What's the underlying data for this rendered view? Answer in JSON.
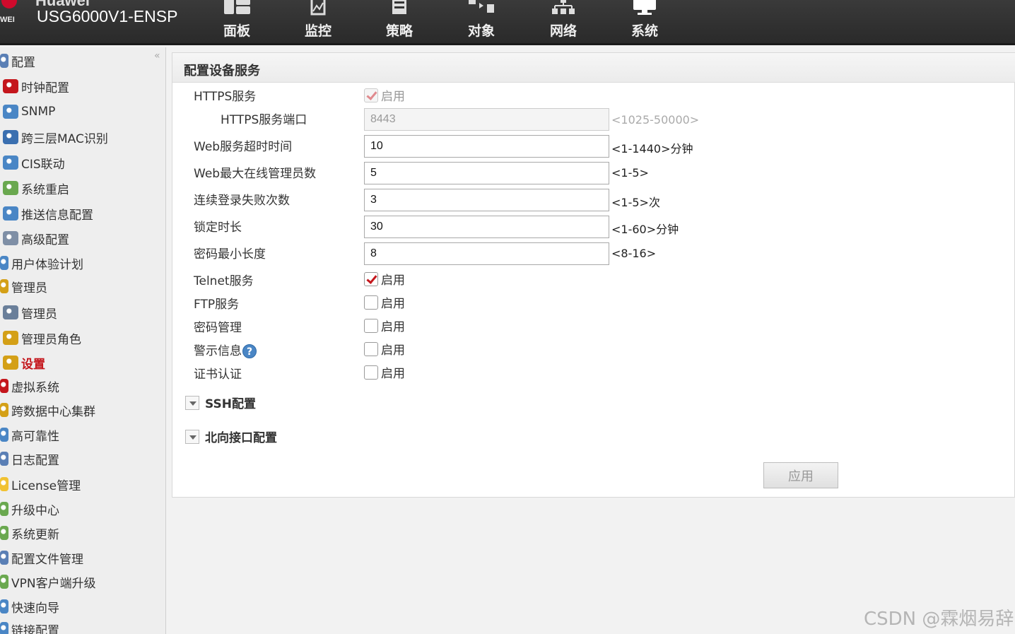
{
  "header": {
    "brand_top": "Huawei",
    "brand_short": "WEI",
    "device_name": "USG6000V1-ENSP",
    "nav": [
      {
        "label": "面板",
        "icon": "dashboard-icon"
      },
      {
        "label": "监控",
        "icon": "monitor-icon"
      },
      {
        "label": "策略",
        "icon": "policy-icon"
      },
      {
        "label": "对象",
        "icon": "object-icon"
      },
      {
        "label": "网络",
        "icon": "network-icon"
      },
      {
        "label": "系统",
        "icon": "system-icon"
      }
    ]
  },
  "sidebar": {
    "collapse_glyph": "«",
    "items": [
      {
        "label": "配置",
        "icon": "config-icon"
      },
      {
        "label": "时钟配置",
        "icon": "clock-icon"
      },
      {
        "label": "SNMP",
        "icon": "snmp-icon"
      },
      {
        "label": "跨三层MAC识别",
        "icon": "mac-icon"
      },
      {
        "label": "CIS联动",
        "icon": "cis-icon"
      },
      {
        "label": "系统重启",
        "icon": "restart-icon"
      },
      {
        "label": "推送信息配置",
        "icon": "push-icon"
      },
      {
        "label": "高级配置",
        "icon": "advanced-icon"
      },
      {
        "label": "用户体验计划",
        "icon": "user-plan-icon"
      },
      {
        "label": "管理员",
        "icon": "admin-group-icon"
      },
      {
        "label": "管理员",
        "icon": "admin-icon"
      },
      {
        "label": "管理员角色",
        "icon": "admin-role-icon"
      },
      {
        "label": "设置",
        "icon": "settings-icon"
      },
      {
        "label": "虚拟系统",
        "icon": "virtual-system-icon"
      },
      {
        "label": "跨数据中心集群",
        "icon": "cluster-icon"
      },
      {
        "label": "高可靠性",
        "icon": "reliability-icon"
      },
      {
        "label": "日志配置",
        "icon": "log-icon"
      },
      {
        "label": "License管理",
        "icon": "license-icon"
      },
      {
        "label": "升级中心",
        "icon": "upgrade-icon"
      },
      {
        "label": "系统更新",
        "icon": "update-icon"
      },
      {
        "label": "配置文件管理",
        "icon": "file-icon"
      },
      {
        "label": "VPN客户端升级",
        "icon": "vpn-icon"
      },
      {
        "label": "快速向导",
        "icon": "wizard-icon"
      },
      {
        "label": "链接配置",
        "icon": "link-icon"
      }
    ]
  },
  "main": {
    "title": "配置设备服务",
    "https_label": "HTTPS服务",
    "https_enable": "启用",
    "https_port_label": "HTTPS服务端口",
    "https_port_value": "8443",
    "https_port_hint": "<1025-50000>",
    "web_timeout_label": "Web服务超时时间",
    "web_timeout_value": "10",
    "web_timeout_hint": "<1-1440>分钟",
    "web_max_admin_label": "Web最大在线管理员数",
    "web_max_admin_value": "5",
    "web_max_admin_hint": "<1-5>",
    "login_fail_label": "连续登录失败次数",
    "login_fail_value": "3",
    "login_fail_hint": "<1-5>次",
    "lock_label": "锁定时长",
    "lock_value": "30",
    "lock_hint": "<1-60>分钟",
    "pwd_min_label": "密码最小长度",
    "pwd_min_value": "8",
    "pwd_min_hint": "<8-16>",
    "telnet_label": "Telnet服务",
    "ftp_label": "FTP服务",
    "pwd_mgmt_label": "密码管理",
    "warning_label": "警示信息",
    "cert_label": "证书认证",
    "enable_label": "启用",
    "help_glyph": "?",
    "ssh_section": "SSH配置",
    "north_section": "北向接口配置",
    "apply_label": "应用"
  },
  "checkboxes": {
    "https": true,
    "telnet": true,
    "ftp": false,
    "pwd_mgmt": false,
    "warning": false,
    "cert": false
  },
  "watermark": "CSDN @霖烟易辞",
  "colors": {
    "topbar": "#2f2f2f",
    "accent_red": "#c4161c",
    "help_blue": "#4a86c5"
  }
}
